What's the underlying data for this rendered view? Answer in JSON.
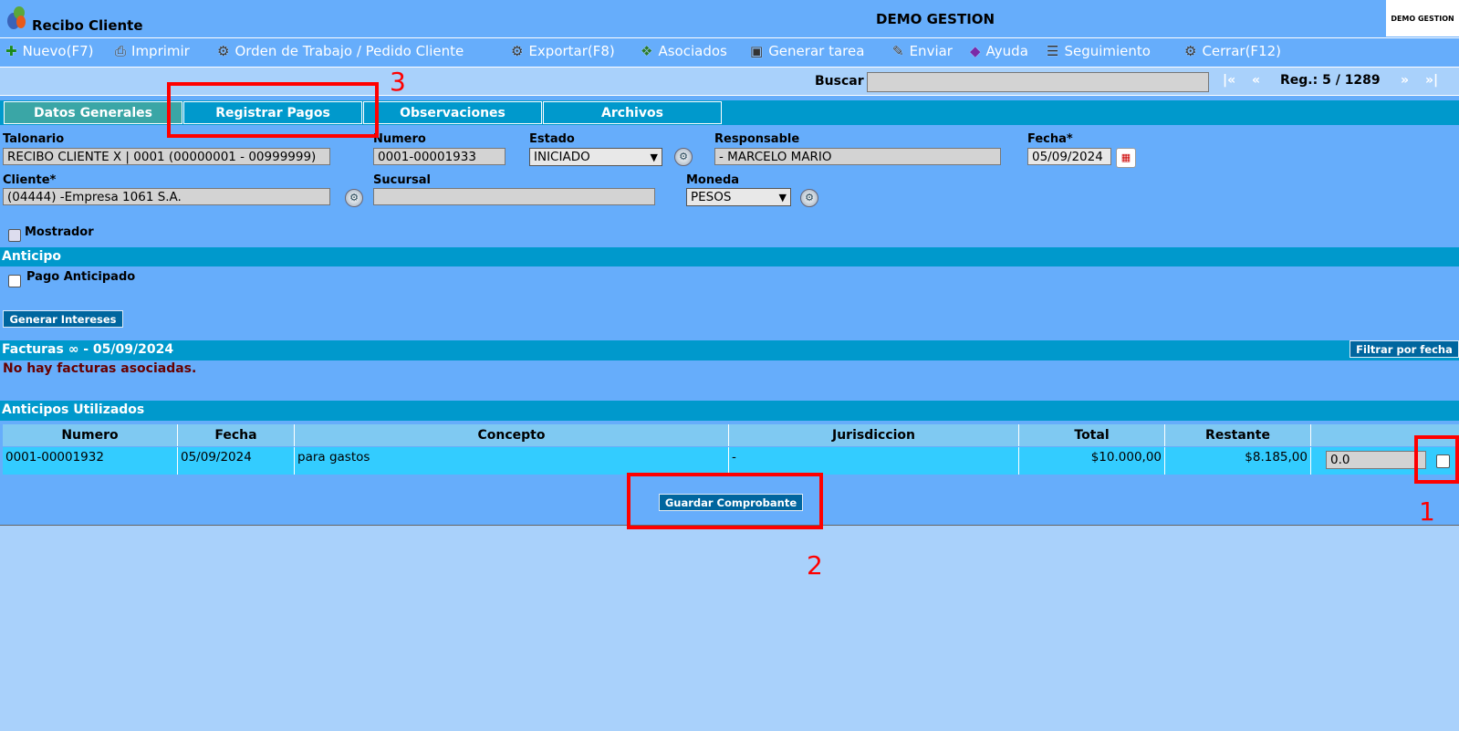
{
  "header": {
    "app_title": "Recibo Cliente",
    "company_title": "DEMO GESTION",
    "logo_text": "DEMO GESTION"
  },
  "toolbar": {
    "items": [
      {
        "label": "Nuevo(F7)",
        "icon": "plus-icon"
      },
      {
        "label": "Imprimir",
        "icon": "printer-icon"
      },
      {
        "label": "Orden de Trabajo / Pedido Cliente",
        "icon": "gear-icon"
      },
      {
        "label": "Exportar(F8)",
        "icon": "export-icon"
      },
      {
        "label": "Asociados",
        "icon": "asociados-icon"
      },
      {
        "label": "Generar tarea",
        "icon": "task-icon"
      },
      {
        "label": "Enviar",
        "icon": "send-icon"
      },
      {
        "label": "Ayuda",
        "icon": "help-icon"
      },
      {
        "label": "Seguimiento",
        "icon": "tracking-icon"
      },
      {
        "label": "Cerrar(F12)",
        "icon": "close-icon"
      }
    ]
  },
  "search": {
    "label": "Buscar",
    "value": "",
    "first": "|«",
    "prev": "«",
    "record": "Reg.: 5 / 1289",
    "next": "»",
    "last": "»|"
  },
  "tabs": [
    "Datos Generales",
    "Registrar Pagos",
    "Observaciones",
    "Archivos"
  ],
  "form": {
    "talonario_label": "Talonario",
    "talonario_value": "RECIBO CLIENTE X | 0001 (00000001 - 00999999)",
    "numero_label": "Numero",
    "numero_value": "0001-00001933",
    "estado_label": "Estado",
    "estado_value": "INICIADO",
    "responsable_label": "Responsable",
    "responsable_value": "- MARCELO MARIO",
    "fecha_label": "Fecha*",
    "fecha_value": "05/09/2024",
    "cliente_label": "Cliente*",
    "cliente_value": "(04444) -Empresa 1061 S.A.",
    "sucursal_label": "Sucursal",
    "sucursal_value": "",
    "moneda_label": "Moneda",
    "moneda_value": "PESOS",
    "mostrador_label": "Mostrador"
  },
  "anticipo": {
    "title": "Anticipo",
    "pago_anticipado_label": "Pago Anticipado",
    "generar_intereses": "Generar Intereses"
  },
  "facturas": {
    "title": "Facturas ∞ - 05/09/2024",
    "filter_button": "Filtrar por fecha",
    "empty_message": "No hay facturas asociadas."
  },
  "anticipos_utilizados": {
    "title": "Anticipos Utilizados",
    "columns": [
      "Numero",
      "Fecha",
      "Concepto",
      "Jurisdiccion",
      "Total",
      "Restante",
      ""
    ],
    "rows": [
      {
        "numero": "0001-00001932",
        "fecha": "05/09/2024",
        "concepto": "para gastos",
        "jurisdiccion": "-",
        "total": "$10.000,00",
        "restante": "$8.185,00",
        "monto": "0.0"
      }
    ]
  },
  "save_button": "Guardar Comprobante",
  "annotations": [
    "1",
    "2",
    "3"
  ]
}
